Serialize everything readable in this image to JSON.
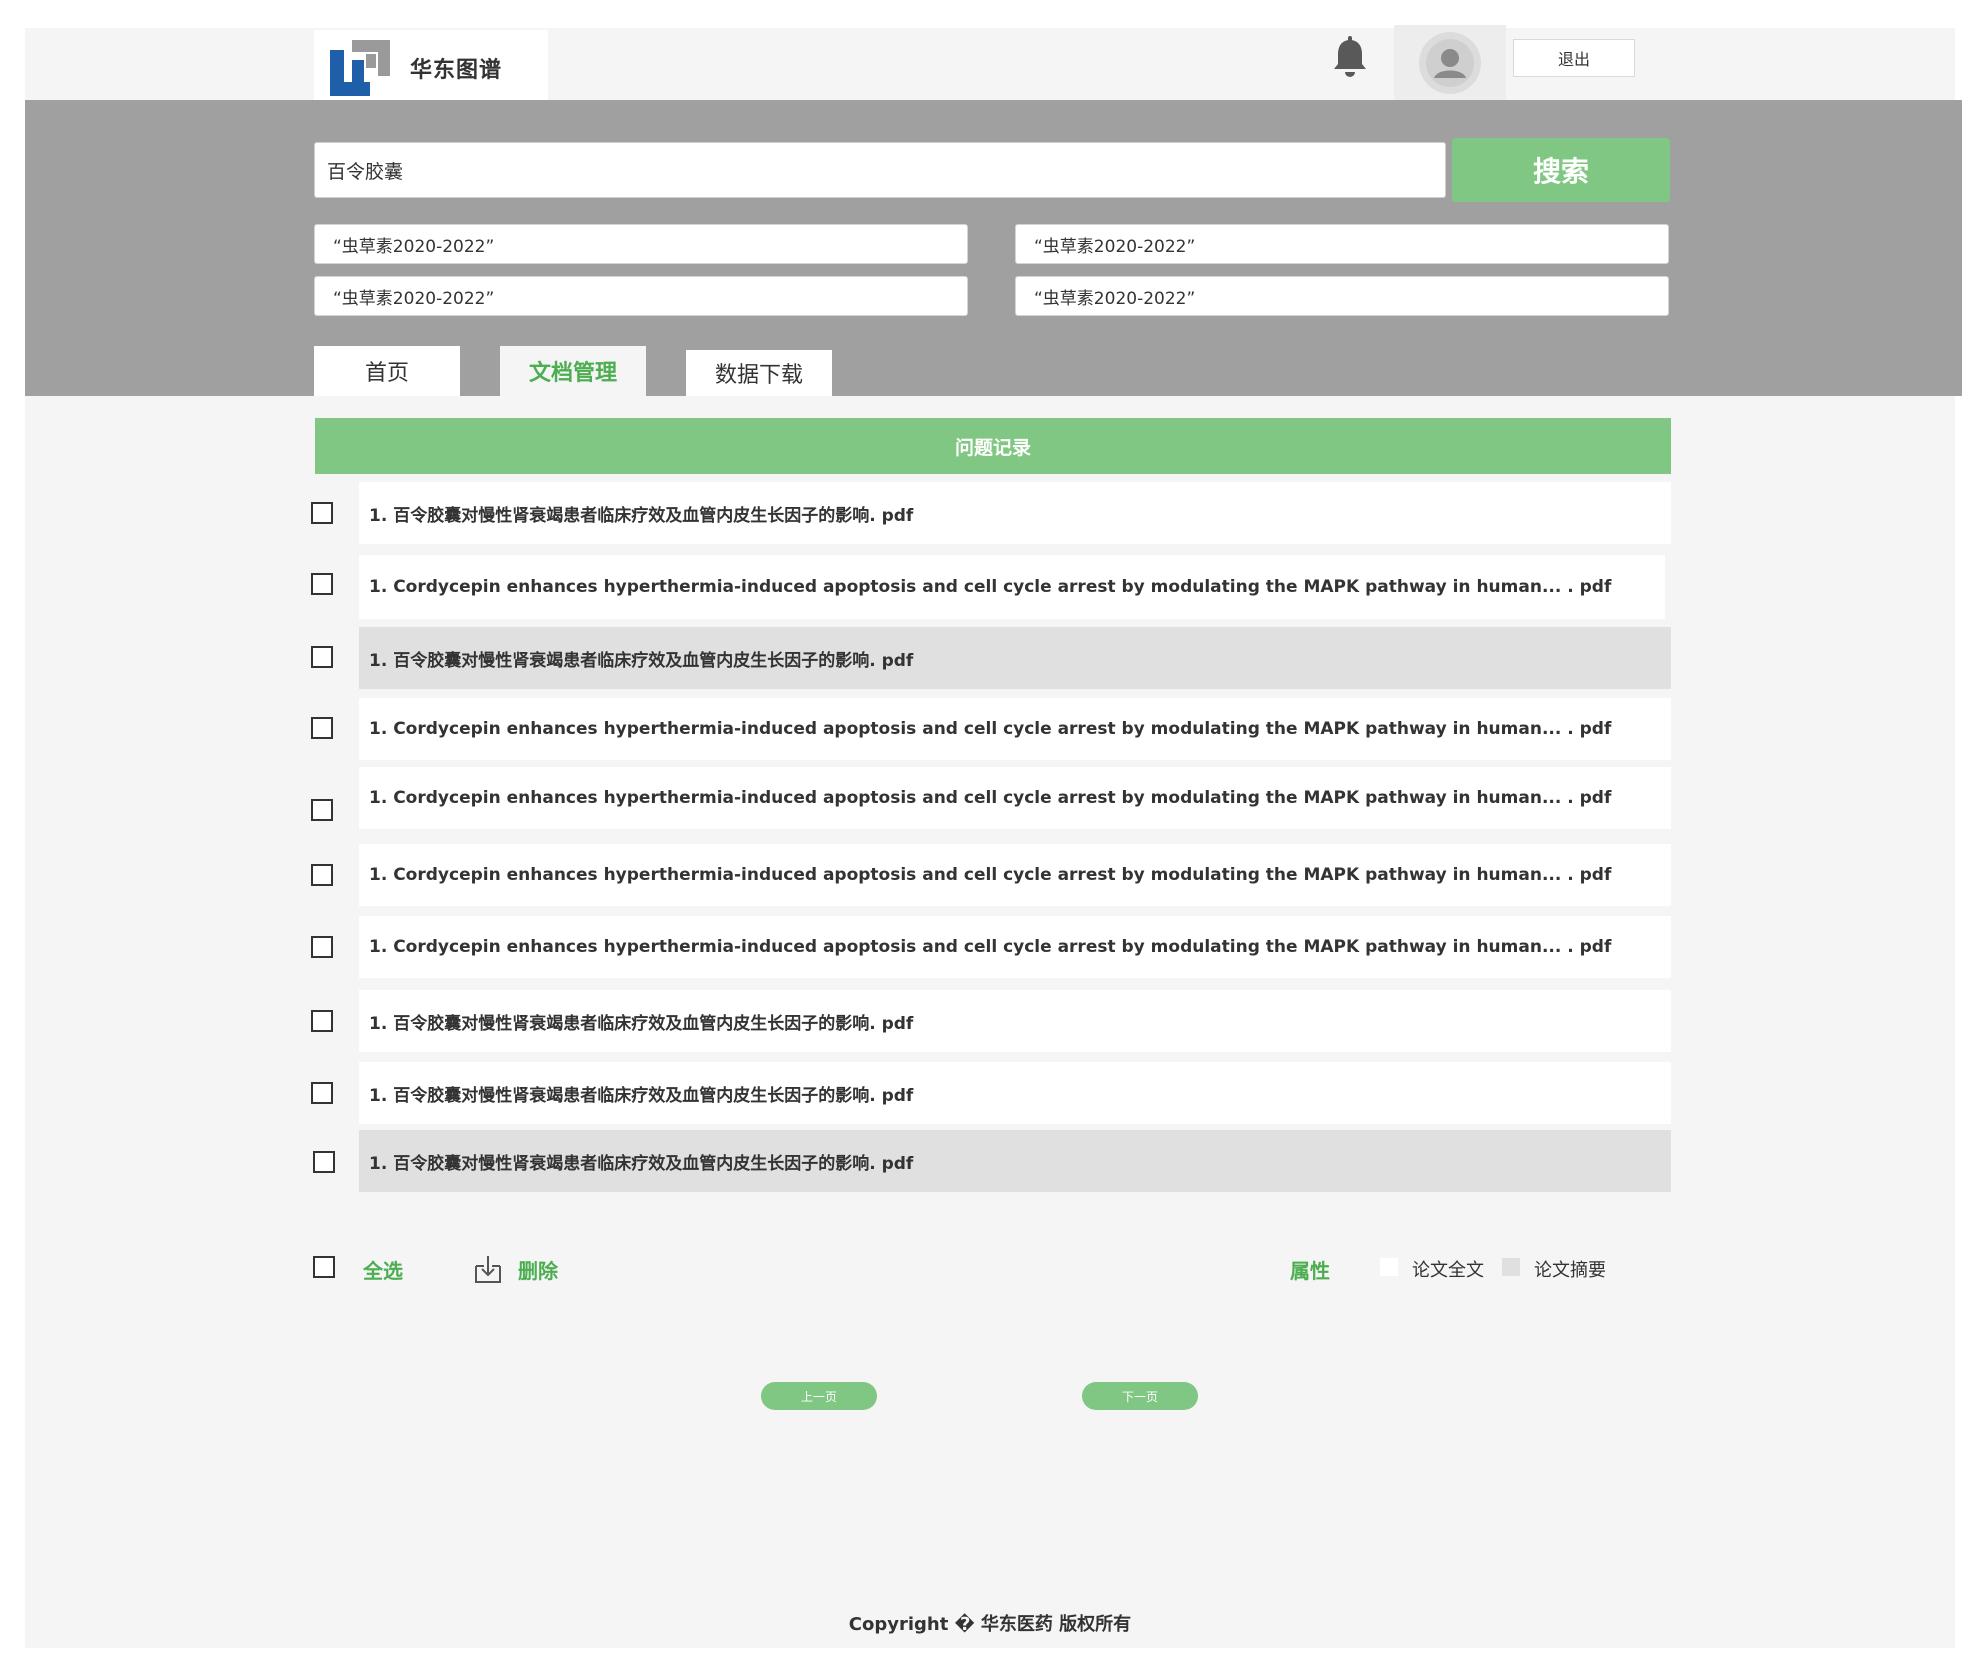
{
  "header": {
    "brand": "华东图谱",
    "logout_label": "退出"
  },
  "search": {
    "query": "百令胶囊",
    "button_label": "搜索",
    "keywords": [
      "“虫草素2020-2022”",
      "“虫草素2020-2022”",
      "“虫草素2020-2022”",
      "“虫草素2020-2022”"
    ]
  },
  "tabs": [
    {
      "label": "首页",
      "active": false
    },
    {
      "label": "文档管理",
      "active": true
    },
    {
      "label": "数据下载",
      "active": false
    }
  ],
  "list": {
    "title": "问题记录",
    "items": [
      {
        "text": "1. 百令胶囊对慢性肾衰竭患者临床疗效及血管内皮生长因子的影响. pdf",
        "shaded": false
      },
      {
        "text": "1. Cordycepin enhances hyperthermia-induced apoptosis and cell cycle arrest by modulating the MAPK pathway in human... . pdf",
        "shaded": false
      },
      {
        "text": "1. 百令胶囊对慢性肾衰竭患者临床疗效及血管内皮生长因子的影响. pdf",
        "shaded": true
      },
      {
        "text": "1. Cordycepin enhances hyperthermia-induced apoptosis and cell cycle arrest by modulating the MAPK pathway in human... . pdf",
        "shaded": false
      },
      {
        "text": "1. Cordycepin enhances hyperthermia-induced apoptosis and cell cycle arrest by modulating the MAPK pathway in human... . pdf",
        "shaded": false
      },
      {
        "text": "1. Cordycepin enhances hyperthermia-induced apoptosis and cell cycle arrest by modulating the MAPK pathway in human... . pdf",
        "shaded": false
      },
      {
        "text": "1. Cordycepin enhances hyperthermia-induced apoptosis and cell cycle arrest by modulating the MAPK pathway in human... . pdf",
        "shaded": false
      },
      {
        "text": "1. 百令胶囊对慢性肾衰竭患者临床疗效及血管内皮生长因子的影响. pdf",
        "shaded": false
      },
      {
        "text": "1. 百令胶囊对慢性肾衰竭患者临床疗效及血管内皮生长因子的影响. pdf",
        "shaded": false
      },
      {
        "text": "1. 百令胶囊对慢性肾衰竭患者临床疗效及血管内皮生长因子的影响. pdf",
        "shaded": true
      }
    ]
  },
  "actions": {
    "select_all": "全选",
    "delete": "删除",
    "property_label": "属性",
    "option_fulltext": "论文全文",
    "option_abstract": "论文摘要"
  },
  "pager": {
    "prev": "上一页",
    "next": "下一页"
  },
  "footer": {
    "copyright": "Copyright � 华东医药 版权所有"
  },
  "colors": {
    "accent": "#7fc782",
    "accent_text": "#4cae50",
    "band": "#a0a0a0",
    "page_bg": "#f5f5f5",
    "row_shaded": "#e0e0e0",
    "logo_blue": "#1f5faa",
    "logo_gray": "#9a9a9a"
  },
  "icons": {
    "logo": "huadong-logo-icon",
    "bell": "bell-icon",
    "avatar": "user-avatar-icon",
    "delete": "download-tray-icon",
    "checkbox": "checkbox-icon"
  }
}
